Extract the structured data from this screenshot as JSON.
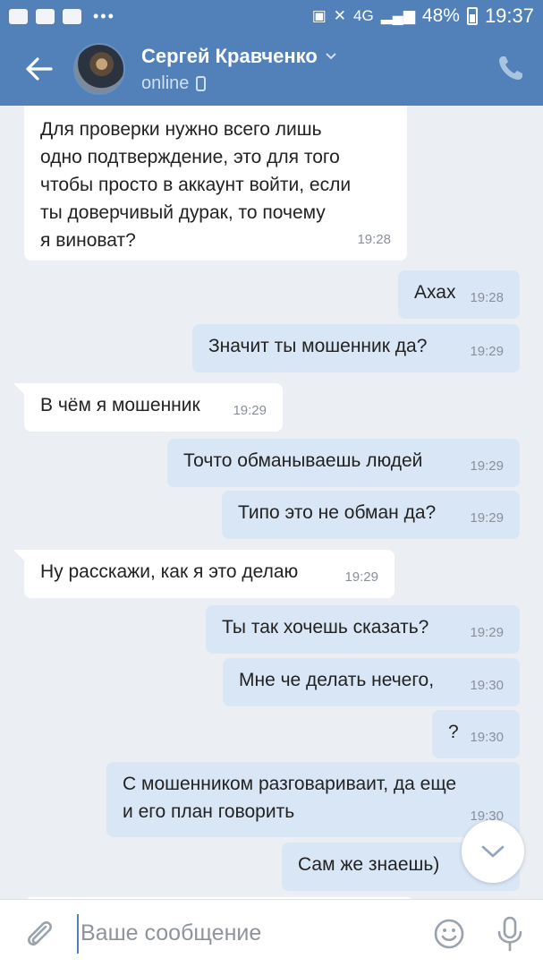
{
  "status_bar": {
    "network": "4G",
    "battery": "48%",
    "time": "19:37"
  },
  "header": {
    "contact_name": "Сергей Кравченко",
    "status": "online"
  },
  "messages": [
    {
      "dir": "in",
      "text": "Для проверки нужно всего лишь\nодно подтверждение, это для того\nчтобы просто в аккаунт войти, если\nты доверчивый дурак, то почему\nя виноват?",
      "time": "19:28"
    },
    {
      "dir": "out",
      "text": "Ахах",
      "time": "19:28"
    },
    {
      "dir": "out",
      "text": "Значит ты мошенник да?",
      "time": "19:29"
    },
    {
      "dir": "in",
      "text": "В чём я мошенник",
      "time": "19:29"
    },
    {
      "dir": "out",
      "text": "Точто обманываешь людей",
      "time": "19:29"
    },
    {
      "dir": "out",
      "text": "Типо это не обман да?",
      "time": "19:29"
    },
    {
      "dir": "in",
      "text": "Ну расскажи, как я это делаю",
      "time": "19:29"
    },
    {
      "dir": "out",
      "text": "Ты так хочешь сказать?",
      "time": "19:29"
    },
    {
      "dir": "out",
      "text": "Мне че делать нечего,",
      "time": "19:30"
    },
    {
      "dir": "out",
      "text": "?",
      "time": "19:30"
    },
    {
      "dir": "out",
      "text": "С мошенником разговариваит, да еще\nи его план говорить",
      "time": "19:30"
    },
    {
      "dir": "out",
      "text": "Сам же знаешь)",
      "time": "19:30"
    }
  ],
  "input": {
    "placeholder": "Ваше сообщение"
  },
  "icons": {
    "back": "arrow-left-icon",
    "phone": "phone-icon",
    "attach": "paperclip-icon",
    "emoji": "smile-icon",
    "mic": "microphone-icon",
    "scroll": "chevron-down-icon"
  },
  "colors": {
    "header": "#5181b8",
    "incoming_bubble": "#ffffff",
    "outgoing_bubble": "#d9e6f6",
    "background": "#ebeef3"
  }
}
